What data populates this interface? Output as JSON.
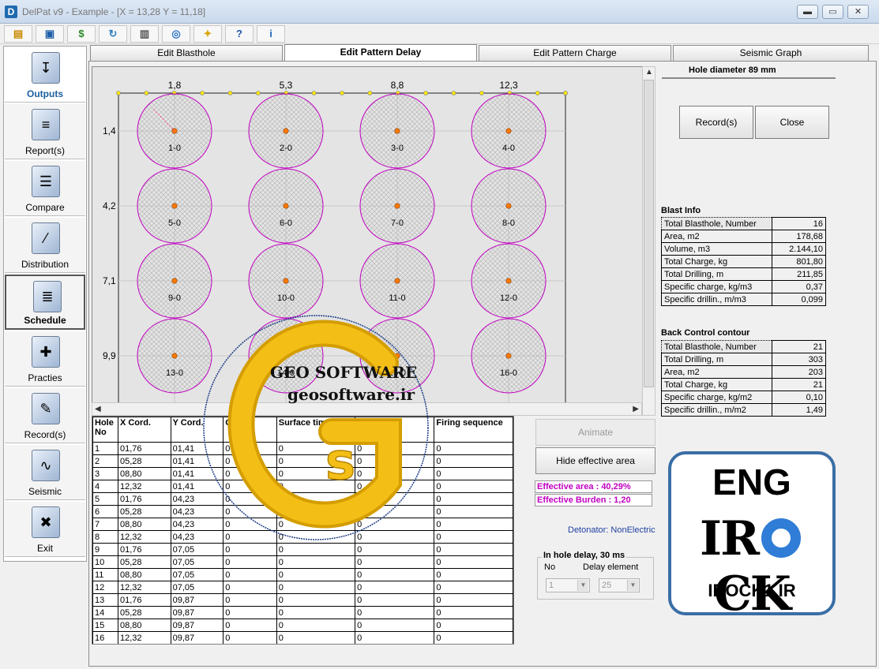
{
  "window": {
    "app_letter": "D",
    "title": "DelPat v9 - Example - [X = 13,28  Y = 11,18]",
    "minimize": "▬",
    "maximize": "▭",
    "close": "✕"
  },
  "toolbar": {
    "buttons": [
      {
        "icon": "open-folder-icon",
        "glyph": "▤"
      },
      {
        "icon": "save-icon",
        "glyph": "▣"
      },
      {
        "icon": "dollar-icon",
        "glyph": "$"
      },
      {
        "icon": "refresh-icon",
        "glyph": "↻"
      },
      {
        "icon": "document-icon",
        "glyph": "▥"
      },
      {
        "icon": "globe-icon",
        "glyph": "◎"
      },
      {
        "icon": "lightbulb-icon",
        "glyph": "✦"
      },
      {
        "icon": "help-icon",
        "glyph": "?"
      },
      {
        "icon": "info-icon",
        "glyph": "i"
      }
    ]
  },
  "sidebar": {
    "items": [
      {
        "label": "Outputs",
        "icon": "export-icon",
        "glyph": "↧"
      },
      {
        "label": "Report(s)",
        "icon": "report-icon",
        "glyph": "≡"
      },
      {
        "label": "Compare",
        "icon": "clipboard-icon",
        "glyph": "☰"
      },
      {
        "label": "Distribution",
        "icon": "distribution-chart-icon",
        "glyph": "⁄"
      },
      {
        "label": "Schedule",
        "icon": "notepad-icon",
        "glyph": "≣"
      },
      {
        "label": "Practies",
        "icon": "grid-layout-icon",
        "glyph": "✚"
      },
      {
        "label": "Record(s)",
        "icon": "pen-paper-icon",
        "glyph": "✎"
      },
      {
        "label": "Seismic",
        "icon": "seismograph-icon",
        "glyph": "∿"
      },
      {
        "label": "Exit",
        "icon": "exit-icon",
        "glyph": "✖"
      }
    ]
  },
  "tabs": [
    "Edit Blasthole",
    "Edit Pattern Delay",
    "Edit Pattern Charge",
    "Seismic Graph"
  ],
  "pattern": {
    "x_ticks": [
      "1,8",
      "5,3",
      "8,8",
      "12,3"
    ],
    "y_ticks": [
      "1,4",
      "4,2",
      "7,1",
      "9,9"
    ],
    "holes": [
      "1-0",
      "2-0",
      "3-0",
      "4-0",
      "5-0",
      "6-0",
      "7-0",
      "8-0",
      "9-0",
      "10-0",
      "11-0",
      "12-0",
      "13-0",
      "14-0",
      "15-0",
      "16-0"
    ]
  },
  "grid": {
    "headers": [
      "Hole No",
      "X Cord.",
      "Y Cord.",
      "G... No",
      "Surface time, mse",
      "...me, m...",
      "Firing sequence"
    ],
    "rows": [
      [
        "1",
        "01,76",
        "01,41",
        "0",
        "0",
        "0",
        "0"
      ],
      [
        "2",
        "05,28",
        "01,41",
        "0",
        "0",
        "0",
        "0"
      ],
      [
        "3",
        "08,80",
        "01,41",
        "0",
        "0",
        "0",
        "0"
      ],
      [
        "4",
        "12,32",
        "01,41",
        "0",
        "0",
        "0",
        "0"
      ],
      [
        "5",
        "01,76",
        "04,23",
        "0",
        "0",
        "0",
        "0"
      ],
      [
        "6",
        "05,28",
        "04,23",
        "0",
        "0",
        "0",
        "0"
      ],
      [
        "7",
        "08,80",
        "04,23",
        "0",
        "0",
        "0",
        "0"
      ],
      [
        "8",
        "12,32",
        "04,23",
        "0",
        "0",
        "0",
        "0"
      ],
      [
        "9",
        "01,76",
        "07,05",
        "0",
        "0",
        "0",
        "0"
      ],
      [
        "10",
        "05,28",
        "07,05",
        "0",
        "0",
        "0",
        "0"
      ],
      [
        "11",
        "08,80",
        "07,05",
        "0",
        "0",
        "0",
        "0"
      ],
      [
        "12",
        "12,32",
        "07,05",
        "0",
        "0",
        "0",
        "0"
      ],
      [
        "13",
        "01,76",
        "09,87",
        "0",
        "0",
        "0",
        "0"
      ],
      [
        "14",
        "05,28",
        "09,87",
        "0",
        "0",
        "0",
        "0"
      ],
      [
        "15",
        "08,80",
        "09,87",
        "0",
        "0",
        "0",
        "0"
      ],
      [
        "16",
        "12,32",
        "09,87",
        "0",
        "0",
        "0",
        "0"
      ]
    ]
  },
  "right": {
    "hole_diameter": "Hole diameter 89 mm",
    "records_btn": "Record(s)",
    "close_btn": "Close",
    "blast_info_title": "Blast Info",
    "blast_info": [
      [
        "Total Blasthole, Number",
        "16"
      ],
      [
        "Area, m2",
        "178,68"
      ],
      [
        "Volume, m3",
        "2.144,10"
      ],
      [
        "Total Charge, kg",
        "801,80"
      ],
      [
        "Total Drilling, m",
        "211,85"
      ],
      [
        "Specific charge, kg/m3",
        "0,37"
      ],
      [
        "Specific drillin., m/m3",
        "0,099"
      ]
    ],
    "back_title": "Back Control contour",
    "back_info": [
      [
        "Total Blasthole, Number",
        "21"
      ],
      [
        "Total Drilling, m",
        "303"
      ],
      [
        "Area, m2",
        "203"
      ],
      [
        "Total Charge, kg",
        "21"
      ],
      [
        "Specific charge, kg/m2",
        "0,10"
      ],
      [
        "Specific drillin., m/m2",
        "1,49"
      ]
    ]
  },
  "middle": {
    "animate": "Animate",
    "hide_effective": "Hide effective area",
    "effective_area": "Effective area  : 40,29%",
    "effective_burden": "Effective Burden  : 1,20",
    "detonator": "Detonator: NonElectric",
    "delay_title": "In hole delay, 30 ms",
    "delay_no_label": "No",
    "delay_element_label": "Delay element",
    "delay_no_value": "1",
    "delay_element_value": "25"
  },
  "logos": {
    "geo_name": "GEO SOFTWARE",
    "geo_url": "geosoftware.ir",
    "eng": "ENG",
    "irock": "IROCK",
    "irock_url": "IROCK1.IR"
  }
}
